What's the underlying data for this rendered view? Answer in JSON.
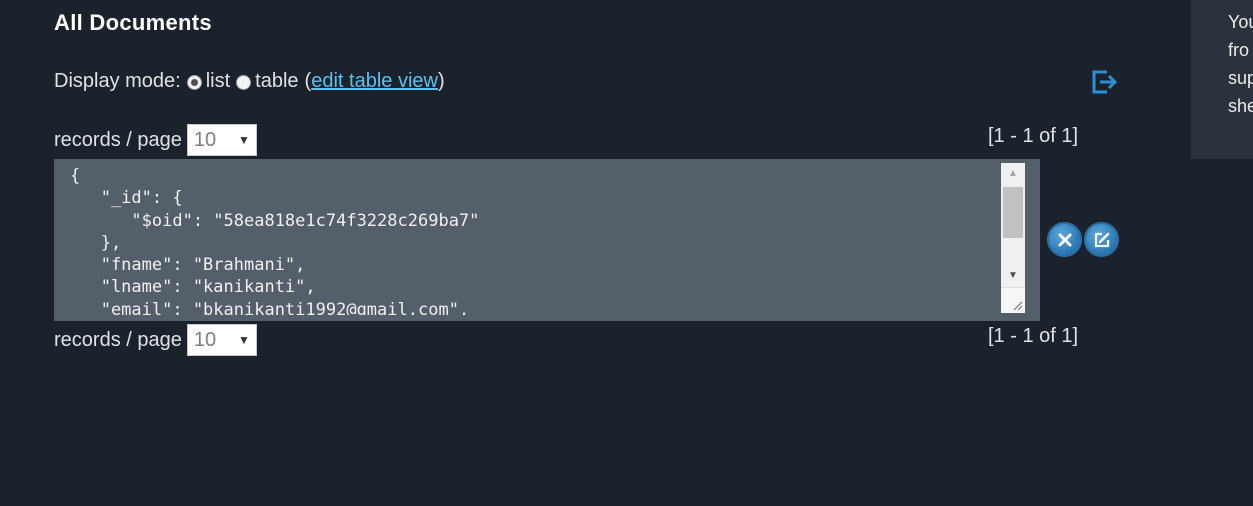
{
  "title": "All Documents",
  "display_mode": {
    "label": "Display mode:",
    "options": [
      {
        "label": "list",
        "checked": true
      },
      {
        "label": "table",
        "checked": false
      }
    ],
    "paren_open": "(",
    "edit_link": "edit table view",
    "paren_close": ")"
  },
  "export_icon": "export-icon",
  "pager": {
    "label": "records / page",
    "selected": "10",
    "count_text": "[1 - 1 of 1]"
  },
  "document": {
    "json_text": "{\n   \"_id\": {\n      \"$oid\": \"58ea818e1c74f3228c269ba7\"\n   },\n   \"fname\": \"Brahmani\",\n   \"lname\": \"kanikanti\",\n   \"email\": \"bkanikanti1992@gmail.com\","
  },
  "actions": {
    "delete_icon": "close-icon",
    "edit_icon": "edit-icon"
  },
  "side_panel": {
    "lines": [
      "You",
      "fro",
      "sup",
      "she"
    ]
  },
  "colors": {
    "background": "#1b222b",
    "document_bg": "#545f69",
    "link": "#5bc0f2",
    "accent_blue": "#2d79b7",
    "panel_bg": "#2b323b"
  }
}
